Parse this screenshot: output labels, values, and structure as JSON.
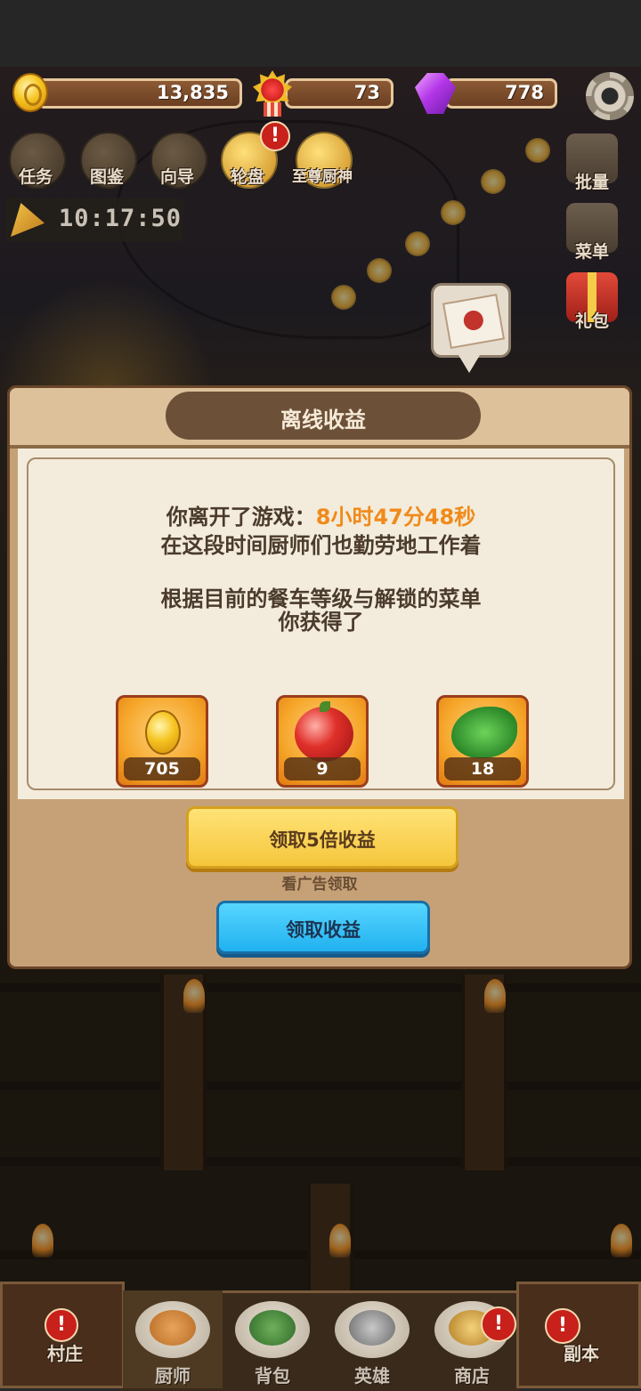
{
  "resources": {
    "coins": "13,835",
    "medals": "73",
    "gems": "778"
  },
  "quick_menu": [
    "任务",
    "图鉴",
    "向导",
    "轮盘",
    "至尊厨神"
  ],
  "timer": "10:17:50",
  "right_menu": [
    "批量",
    "菜单",
    "礼包"
  ],
  "alert_mark": "!",
  "dialog": {
    "title": "离线收益",
    "away_prefix": "你离开了游戏：",
    "away_time": "8小时47分48秒",
    "line2": "在这段时间厨师们也勤劳地工作着",
    "line3": "根据目前的餐车等级与解锁的菜单",
    "line4": "你获得了",
    "rewards": [
      {
        "icon": "coin-icon",
        "count": "705"
      },
      {
        "icon": "meat-icon",
        "count": "9"
      },
      {
        "icon": "vegetable-icon",
        "count": "18"
      }
    ],
    "btn_5x": "领取5倍收益",
    "ad_hint": "看广告领取",
    "btn_claim": "领取收益"
  },
  "bottom_nav": {
    "left": "村庄",
    "tabs": [
      "厨师",
      "背包",
      "英雄",
      "商店"
    ],
    "right": "副本"
  },
  "colors": {
    "highlight": "#f08a1a",
    "yellow_button": "#f5c63c",
    "blue_button": "#20b1ef"
  }
}
